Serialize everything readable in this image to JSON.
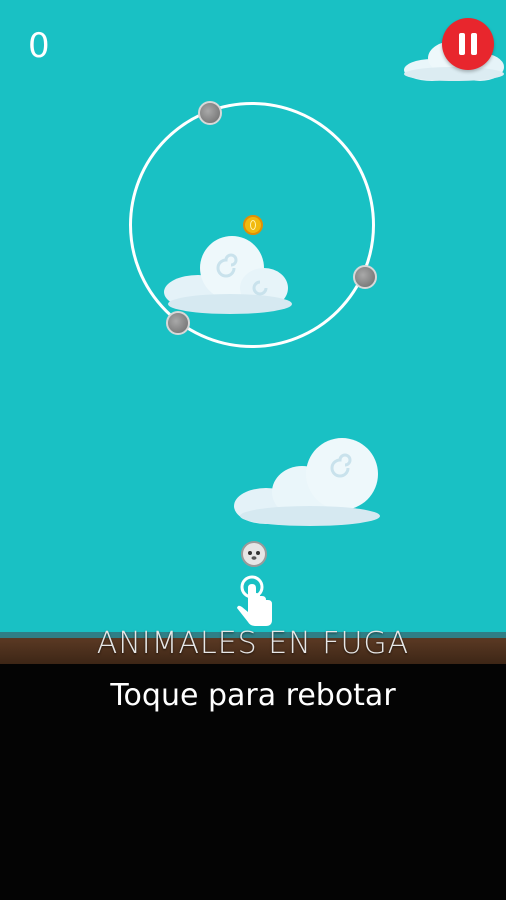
{
  "hud": {
    "score": "0",
    "pause_icon": "pause-icon"
  },
  "game": {
    "coin_icon": "coin-icon",
    "spike_icon": "spiked-ball-icon",
    "player_icon": "animal-ball-icon",
    "tap_icon": "tap-hand-icon"
  },
  "footer": {
    "title": "ANIMALES EN FUGA",
    "instruction": "Toque para rebotar"
  },
  "colors": {
    "sky": "#19c1c4",
    "pause_button": "#e8262d",
    "coin": "#f1b90e"
  }
}
